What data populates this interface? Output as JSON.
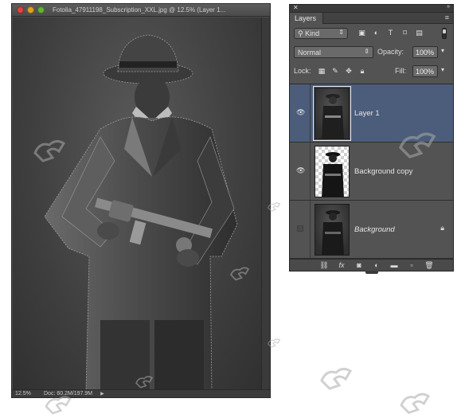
{
  "document": {
    "title": "Fotolia_47911198_Subscription_XXL.jpg @ 12.5% (Layer 1...",
    "zoom": "12.5%",
    "doc_info": "Doc: 60.2M/197.9M"
  },
  "layers_panel": {
    "tab_label": "Layers",
    "filter": {
      "label": "Kind"
    },
    "blend_mode": "Normal",
    "opacity_label": "Opacity:",
    "opacity_value": "100%",
    "lock_label": "Lock:",
    "fill_label": "Fill:",
    "fill_value": "100%",
    "layers": [
      {
        "name": "Layer 1",
        "selected": true,
        "visible": true
      },
      {
        "name": "Background copy",
        "selected": false,
        "visible": true
      },
      {
        "name": "Background",
        "selected": false,
        "visible": false,
        "locked": true
      }
    ]
  },
  "colors": {
    "panel_bg": "#535353",
    "selected_layer": "#4b5d7b",
    "canvas_bg": "#3f3f3f"
  },
  "icons": {
    "eye": "eye-icon",
    "lock": "lock-icon",
    "link": "link-layers-icon",
    "fx": "fx-icon",
    "mask": "mask-icon",
    "adjustment": "adjustment-icon",
    "folder": "folder-icon",
    "new_layer": "new-layer-icon",
    "trash": "trash-icon"
  }
}
